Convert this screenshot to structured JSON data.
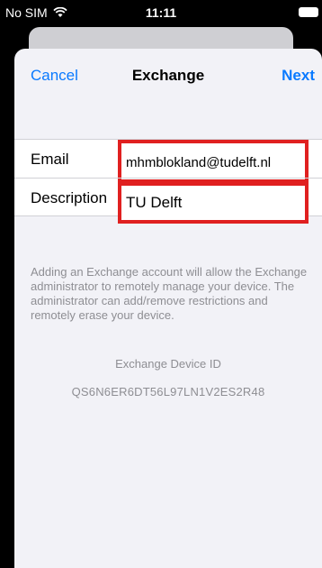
{
  "status_bar": {
    "carrier": "No SIM",
    "time": "11:11",
    "icons": [
      "wifi-icon",
      "battery-icon"
    ]
  },
  "nav": {
    "cancel_label": "Cancel",
    "title": "Exchange",
    "next_label": "Next"
  },
  "form": {
    "email_label": "Email",
    "email_value": "mhmblokland@tudelft.nl",
    "description_label": "Description",
    "description_value": "TU Delft"
  },
  "info_text": "Adding an Exchange account will allow the Exchange administrator to remotely manage your device. The administrator can add/remove restrictions and remotely erase your device.",
  "device_id": {
    "label": "Exchange Device ID",
    "value": "QS6N6ER6DT56L97LN1V2ES2R48"
  },
  "colors": {
    "accent": "#0a7aff",
    "highlight_border": "#e02020",
    "secondary_text": "#8e8e93",
    "background": "#f2f2f7"
  }
}
